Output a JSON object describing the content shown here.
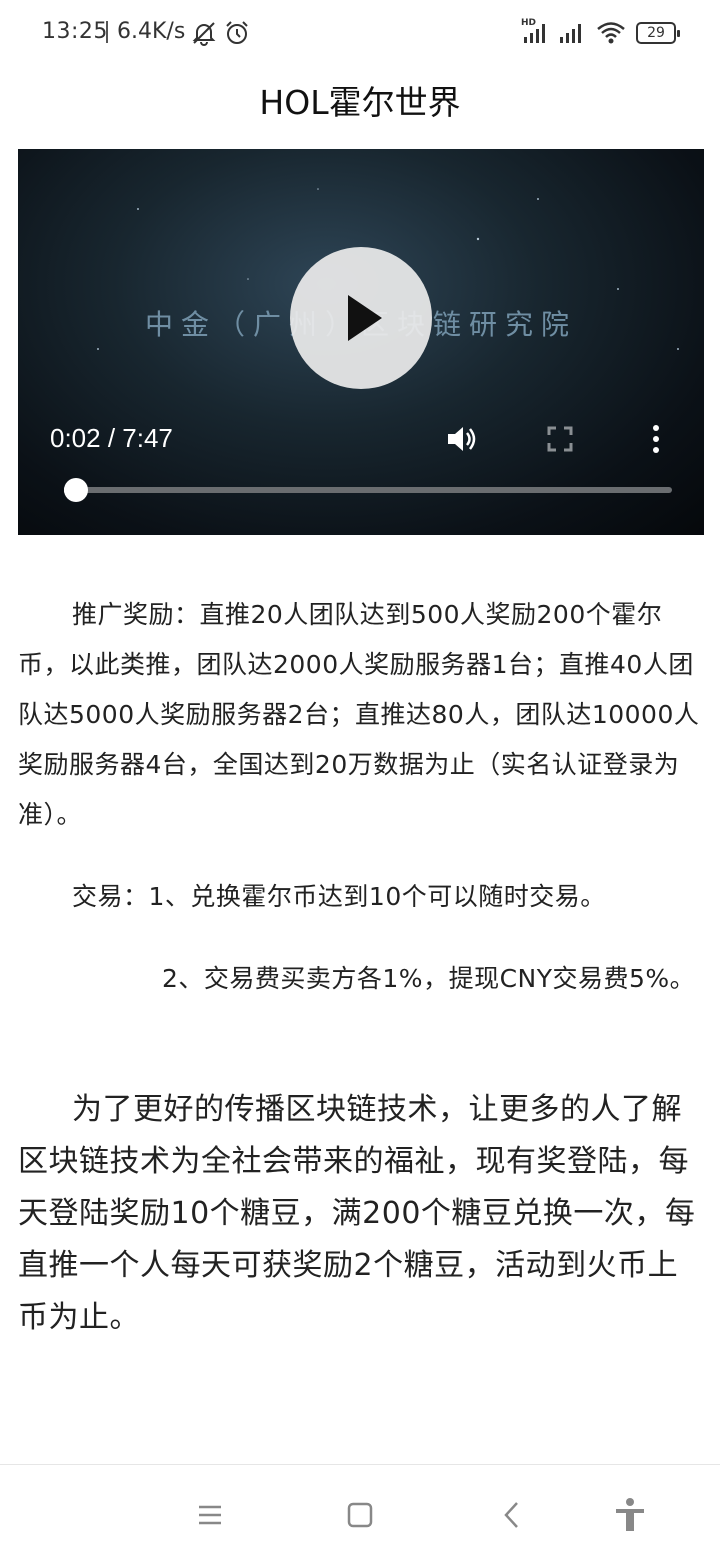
{
  "status_bar": {
    "time": "13:25",
    "net_speed": "6.4K/s",
    "hd_label": "HD",
    "battery": "29"
  },
  "header": {
    "title": "HOL霍尔世界"
  },
  "video": {
    "overlay_text": "中金（广州）区块链研究院",
    "current_time": "0:02 / 7:47",
    "progress_fraction": 0.005
  },
  "content": {
    "para1": "推广奖励：直推20人团队达到500人奖励200个霍尔币，以此类推，团队达2000人奖励服务器1台；直推40人团队达5000人奖励服务器2台；直推达80人，团队达10000人奖励服务器4台，全国达到20万数据为止（实名认证登录为准）。",
    "para2": "交易：1、兑换霍尔币达到10个可以随时交易。",
    "para3": "2、交易费买卖方各1%，提现CNY交易费5%。",
    "para4": "为了更好的传播区块链技术，让更多的人了解区块链技术为全社会带来的福祉，现有奖登陆，每天登陆奖励10个糖豆，满200个糖豆兑换一次，每直推一个人每天可获奖励2个糖豆，活动到火币上币为止。"
  },
  "nav": {
    "icons": [
      "menu-icon",
      "home-square-icon",
      "back-icon",
      "accessibility-icon"
    ]
  }
}
